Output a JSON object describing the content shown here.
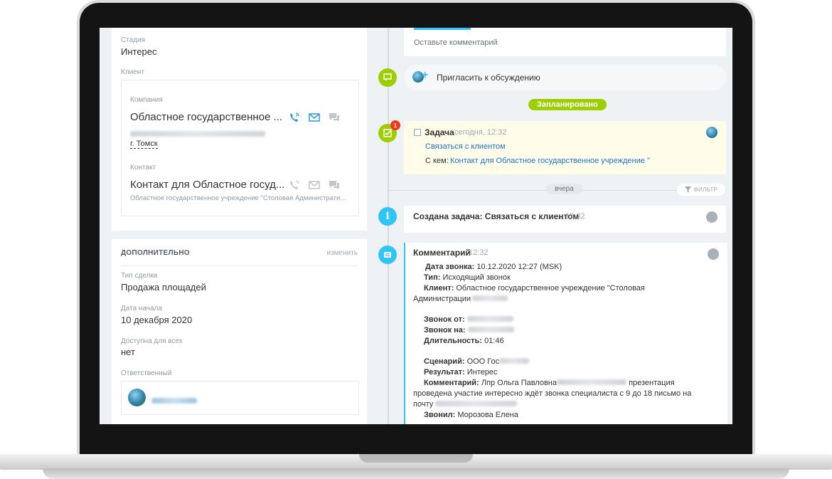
{
  "left": {
    "stage": {
      "label": "Стадия",
      "value": "Интерес"
    },
    "client_label": "Клиент",
    "company": {
      "label": "Компания",
      "name": "Областное государственное ...",
      "city": "г. Томск"
    },
    "contact": {
      "label": "Контакт",
      "name": "Контакт для Областное госуд...",
      "org": "Областное государственное учреждение \"Столовая Администрати..."
    },
    "additional": {
      "title": "ДОПОЛНИТЕЛЬНО",
      "edit_label": "изменить",
      "deal_type": {
        "label": "Тип сделки",
        "value": "Продажа площадей"
      },
      "start_date": {
        "label": "Дата начала",
        "value": "10 декабря 2020"
      },
      "available": {
        "label": "Доступна для всех",
        "value": "нет"
      },
      "responsible": {
        "label": "Ответственный"
      }
    }
  },
  "timeline": {
    "comment_placeholder": "Оставьте комментарий",
    "invite_label": "Пригласить к обсуждению",
    "planned_badge": "Запланировано",
    "task_counter": "1",
    "task": {
      "title": "Задача",
      "time": "сегодня, 12:32",
      "link": "Связаться с клиентом",
      "with_label": "С кем:",
      "with_value": "Контакт для Областное государственное учреждение \""
    },
    "yesterday_badge": "вчера",
    "filter_label": "ФИЛЬТР",
    "created": {
      "title": "Создана задача: Связаться с клиентом",
      "time": "12:32"
    },
    "comment": {
      "title": "Комментарий",
      "time": "12:32",
      "lines": {
        "l1k": "Дата звонка:",
        "l1v": "10.12.2020 12:27 (MSK)",
        "l2k": "Тип:",
        "l2v": "Исходящий звонок",
        "l3k": "Клиент:",
        "l3v": "Областное государственное учреждение \"Столовая",
        "l3b": "Администрации",
        "l4k": "Звонок от:",
        "l5k": "Звонок на:",
        "l6k": "Длительность:",
        "l6v": "01:46",
        "l7k": "Сценарий:",
        "l7v": "ООО Гос",
        "l8k": "Результат:",
        "l8v": "Интерес",
        "l9k": "Комментарий:",
        "l9v": "Лпр Ольга Павловна",
        "l9v2": "презентация",
        "l10": "проведена участие интересно ждёт звонка специалиста с 9 до 18 письмо на",
        "l11": "почту",
        "l12k": "Звонил:",
        "l12v": "Морозова Елена"
      }
    }
  },
  "colors": {
    "green": "#9dcf00",
    "blue": "#2fc6f6",
    "link": "#1a73c5",
    "task_bg": "#fffde9"
  }
}
